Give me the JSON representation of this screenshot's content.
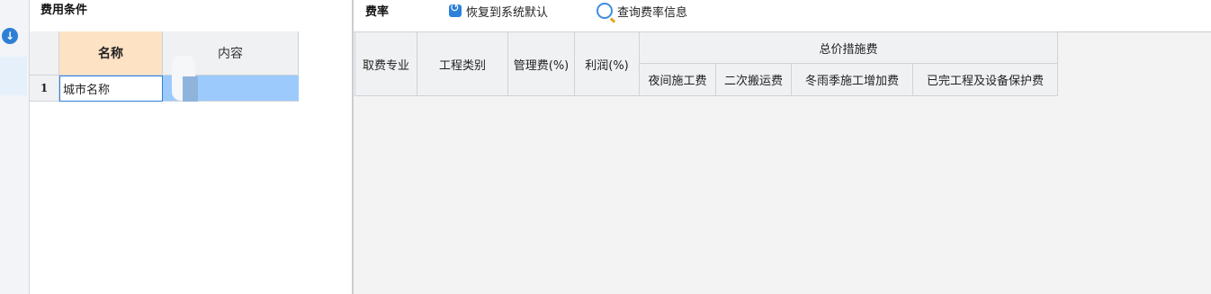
{
  "left_panel": {
    "title": "费用条件",
    "columns": [
      "名称",
      "内容"
    ],
    "rows": [
      {
        "index": "1",
        "name": "城市名称",
        "content": ""
      }
    ]
  },
  "right_panel": {
    "title": "费率",
    "toolbar": {
      "restore_label": "恢复到系统默认",
      "query_label": "查询费率信息"
    },
    "table": {
      "col_specialty": "取费专业",
      "col_category": "工程类别",
      "col_management": "管理费(%)",
      "col_profit": "利润(%)",
      "group_header": "总价措施费",
      "sub_cols": [
        "夜间施工费",
        "二次搬运费",
        "冬雨季施工增加费",
        "已完工程及设备保护费"
      ]
    }
  },
  "icons": {
    "strip": "download-arrow-icon",
    "restore": "restore-icon",
    "query": "query-magnifier-icon"
  }
}
